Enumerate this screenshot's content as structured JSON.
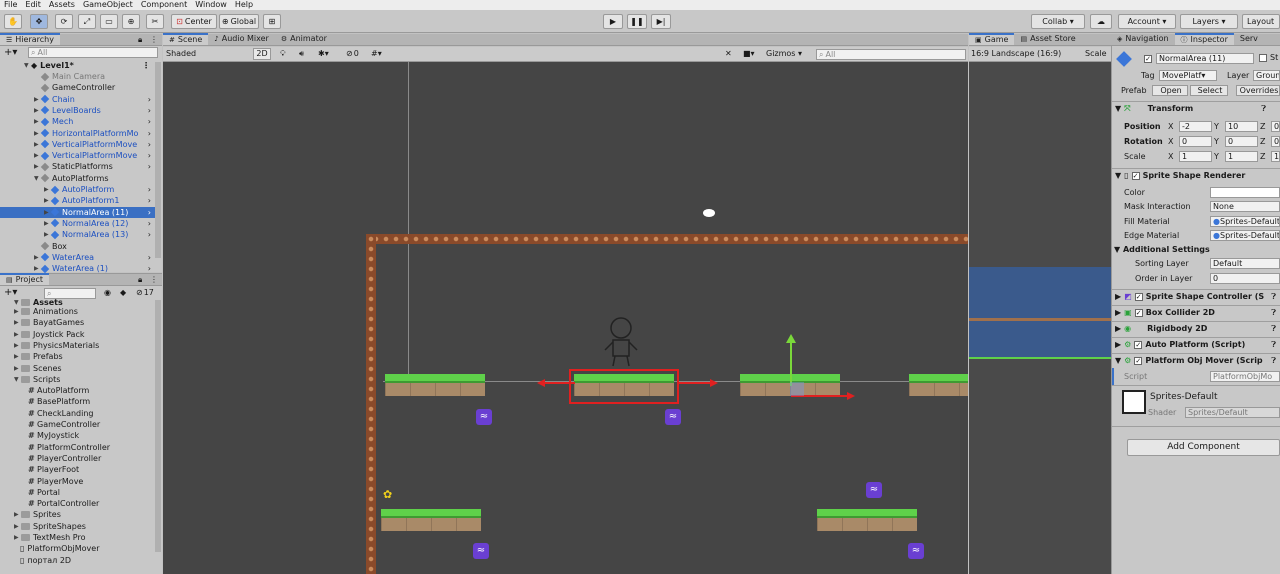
{
  "menu": [
    "File",
    "Edit",
    "Assets",
    "GameObject",
    "Component",
    "Window",
    "Help"
  ],
  "toolbar": {
    "center_label": "Center",
    "global_label": "Global",
    "collab_label": "Collab ▾",
    "account_label": "Account",
    "layers_label": "Layers",
    "layout_label": "Layout"
  },
  "hierarchy": {
    "tab": "Hierarchy",
    "search_placeholder": "All",
    "scene_name": "Level1*",
    "items": [
      {
        "label": "Main Camera",
        "indent": 1,
        "style": "grayt",
        "icon": "gray",
        "arrow": ""
      },
      {
        "label": "GameController",
        "indent": 1,
        "style": "",
        "icon": "gray",
        "arrow": ""
      },
      {
        "label": "Chain",
        "indent": 1,
        "style": "blue",
        "icon": "blue",
        "arrow": "▶"
      },
      {
        "label": "LevelBoards",
        "indent": 1,
        "style": "blue",
        "icon": "blue",
        "arrow": "▶"
      },
      {
        "label": "Mech",
        "indent": 1,
        "style": "blue",
        "icon": "blue",
        "arrow": "▶"
      },
      {
        "label": "HorizontalPlatformMo",
        "indent": 1,
        "style": "blue",
        "icon": "blue",
        "arrow": "▶"
      },
      {
        "label": "VerticalPlatformMove",
        "indent": 1,
        "style": "blue",
        "icon": "blue",
        "arrow": "▶"
      },
      {
        "label": "VerticalPlatformMove",
        "indent": 1,
        "style": "blue",
        "icon": "blue",
        "arrow": "▶"
      },
      {
        "label": "StaticPlatforms",
        "indent": 1,
        "style": "",
        "icon": "gray",
        "arrow": "▶"
      },
      {
        "label": "AutoPlatforms",
        "indent": 1,
        "style": "",
        "icon": "gray",
        "arrow": "▼"
      },
      {
        "label": "AutoPlatform",
        "indent": 2,
        "style": "blue",
        "icon": "blue",
        "arrow": "▶"
      },
      {
        "label": "AutoPlatform1",
        "indent": 2,
        "style": "blue",
        "icon": "blue",
        "arrow": "▶"
      },
      {
        "label": "NormalArea (11)",
        "indent": 2,
        "style": "sel",
        "icon": "blue",
        "arrow": "▶"
      },
      {
        "label": "NormalArea (12)",
        "indent": 2,
        "style": "blue",
        "icon": "blue",
        "arrow": "▶"
      },
      {
        "label": "NormalArea (13)",
        "indent": 2,
        "style": "blue",
        "icon": "blue",
        "arrow": "▶"
      },
      {
        "label": "Box",
        "indent": 1,
        "style": "",
        "icon": "gray",
        "arrow": ""
      },
      {
        "label": "WaterArea",
        "indent": 1,
        "style": "blue",
        "icon": "blue",
        "arrow": "▶"
      },
      {
        "label": "WaterArea (1)",
        "indent": 1,
        "style": "blue",
        "icon": "blue",
        "arrow": "▶"
      }
    ]
  },
  "project": {
    "tab": "Project",
    "badge": "17",
    "root": "Assets",
    "folders": [
      "Animations",
      "BayatGames",
      "Joystick Pack",
      "PhysicsMaterials",
      "Prefabs",
      "Scenes"
    ],
    "scripts_folder": "Scripts",
    "scripts": [
      "AutoPlatform",
      "BasePlatform",
      "CheckLanding",
      "GameController",
      "MyJoystick",
      "PlatformController",
      "PlayerController",
      "PlayerFoot",
      "PlayerMove",
      "Portal",
      "PortalController"
    ],
    "after_folders": [
      "Sprites",
      "SpriteShapes",
      "TextMesh Pro"
    ],
    "files": [
      "PlatformObjMover",
      "портал 2D"
    ]
  },
  "scene": {
    "tabs": [
      "Scene",
      "Audio Mixer",
      "Animator"
    ],
    "shading": "Shaded",
    "mode_2d": "2D",
    "hidden_count": "0",
    "gizmos": "Gizmos",
    "search_placeholder": "All"
  },
  "game": {
    "tabs": [
      "Game",
      "Asset Store"
    ],
    "aspect": "16:9 Landscape (16:9)",
    "scale_label": "Scale"
  },
  "inspector": {
    "tabs": [
      "Navigation",
      "Inspector",
      "Serv"
    ],
    "object_name": "NormalArea (11)",
    "static_label": "St",
    "tag_label": "Tag",
    "tag_value": "MovePlatf",
    "layer_label": "Layer",
    "layer_value": "Groun",
    "prefab_label": "Prefab",
    "open_label": "Open",
    "select_label": "Select",
    "overrides_label": "Overrides",
    "transform": {
      "title": "Transform",
      "position": {
        "label": "Position",
        "x": "-2",
        "y": "10",
        "z": "0"
      },
      "rotation": {
        "label": "Rotation",
        "x": "0",
        "y": "0",
        "z": "0"
      },
      "scale": {
        "label": "Scale",
        "x": "1",
        "y": "1",
        "z": "1"
      }
    },
    "ssr": {
      "title": "Sprite Shape Renderer",
      "color_label": "Color",
      "mask_label": "Mask Interaction",
      "mask_value": "None",
      "fill_label": "Fill Material",
      "fill_value": "Sprites-Default",
      "edge_label": "Edge Material",
      "edge_value": "Sprites-Default",
      "additional": "Additional Settings",
      "sorting_label": "Sorting Layer",
      "sorting_value": "Default",
      "order_label": "Order in Layer",
      "order_value": "0"
    },
    "components": [
      "Sprite Shape Controller (S",
      "Box Collider 2D",
      "Rigidbody 2D",
      "Auto Platform (Script)",
      "Platform Obj Mover (Scrip"
    ],
    "script_label": "Script",
    "script_value": "PlatformObjMo",
    "material_name": "Sprites-Default",
    "shader_label": "Shader",
    "shader_value": "Sprites/Default",
    "add_component": "Add Component"
  }
}
